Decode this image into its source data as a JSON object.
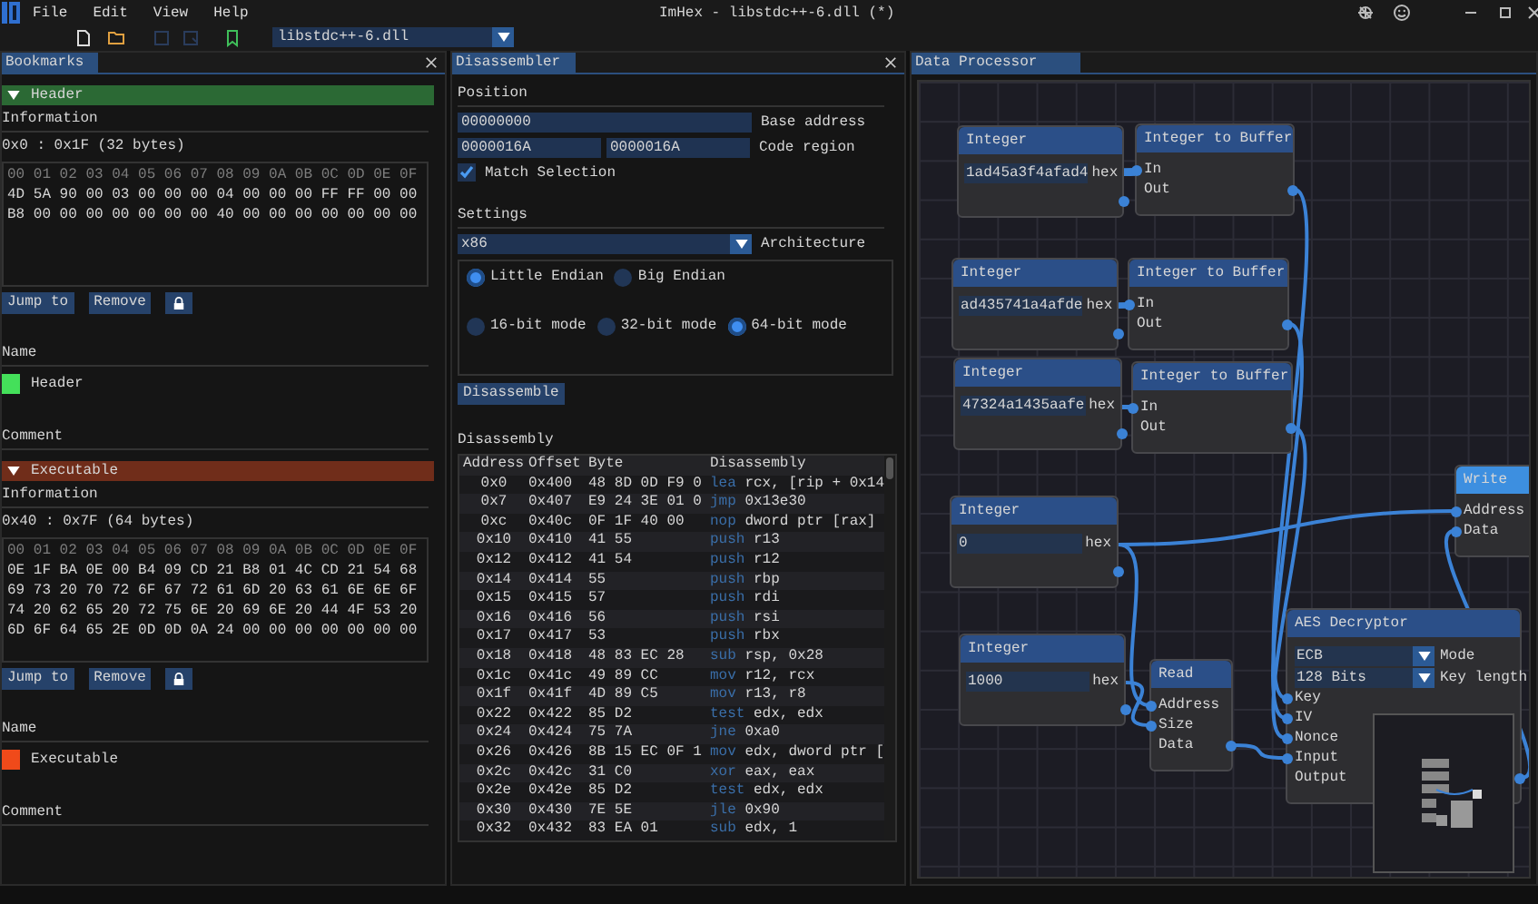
{
  "window": {
    "title": "ImHex - libstdc++-6.dll (*)"
  },
  "menu": [
    "File",
    "Edit",
    "View",
    "Help"
  ],
  "toolbar": {
    "file_selector": "libstdc++-6.dll"
  },
  "bookmarks": {
    "tab": "Bookmarks",
    "items": [
      {
        "title": "Header",
        "expanded": true,
        "color": "#44e05a",
        "info_label": "Information",
        "range": "0x0 : 0x1F (32 bytes)",
        "hex_header": "00 01 02 03 04 05 06 07 08 09 0A 0B 0C 0D 0E 0F",
        "hex_rows": [
          "4D 5A 90 00 03 00 00 00 04 00 00 00 FF FF 00 00",
          "B8 00 00 00 00 00 00 00 40 00 00 00 00 00 00 00"
        ],
        "buttons": [
          "Jump to",
          "Remove"
        ],
        "name_label": "Name",
        "name": "Header",
        "comment_label": "Comment"
      },
      {
        "title": "Executable",
        "expanded": true,
        "color": "#f04a1a",
        "info_label": "Information",
        "range": "0x40 : 0x7F (64 bytes)",
        "hex_header": "00 01 02 03 04 05 06 07 08 09 0A 0B 0C 0D 0E 0F",
        "hex_rows": [
          "0E 1F BA 0E 00 B4 09 CD 21 B8 01 4C CD 21 54 68",
          "69 73 20 70 72 6F 67 72 61 6D 20 63 61 6E 6E 6F",
          "74 20 62 65 20 72 75 6E 20 69 6E 20 44 4F 53 20",
          "6D 6F 64 65 2E 0D 0D 0A 24 00 00 00 00 00 00 00"
        ],
        "buttons": [
          "Jump to",
          "Remove"
        ],
        "name_label": "Name",
        "name": "Executable",
        "comment_label": "Comment"
      }
    ]
  },
  "disassembler": {
    "tab": "Disassembler",
    "position_label": "Position",
    "base_address": "00000000",
    "base_address_label": "Base address",
    "code_region": [
      "0000016A",
      "0000016A"
    ],
    "code_region_label": "Code region",
    "match_selection": {
      "label": "Match Selection",
      "checked": true
    },
    "settings_label": "Settings",
    "architecture": "x86",
    "architecture_label": "Architecture",
    "endianness": [
      {
        "label": "Little Endian",
        "selected": true
      },
      {
        "label": "Big Endian",
        "selected": false
      }
    ],
    "modes": [
      {
        "label": "16-bit mode",
        "selected": false
      },
      {
        "label": "32-bit mode",
        "selected": false
      },
      {
        "label": "64-bit mode",
        "selected": true
      }
    ],
    "disassemble_button": "Disassemble",
    "disassembly_label": "Disassembly",
    "table": {
      "columns": [
        "Address",
        "Offset",
        "Byte",
        "Disassembly"
      ],
      "rows": [
        {
          "address": "0x0",
          "offset": "0x400",
          "bytes": "48 8D 0D F9 0",
          "mnemonic": "lea",
          "operands": "rcx, [rip + 0x14"
        },
        {
          "address": "0x7",
          "offset": "0x407",
          "bytes": "E9 24 3E 01 0",
          "mnemonic": "jmp",
          "operands": "0x13e30"
        },
        {
          "address": "0xc",
          "offset": "0x40c",
          "bytes": "0F 1F 40 00",
          "mnemonic": "nop",
          "operands": "dword ptr [rax]"
        },
        {
          "address": "0x10",
          "offset": "0x410",
          "bytes": "41 55",
          "mnemonic": "push",
          "operands": "r13"
        },
        {
          "address": "0x12",
          "offset": "0x412",
          "bytes": "41 54",
          "mnemonic": "push",
          "operands": "r12"
        },
        {
          "address": "0x14",
          "offset": "0x414",
          "bytes": "55",
          "mnemonic": "push",
          "operands": "rbp"
        },
        {
          "address": "0x15",
          "offset": "0x415",
          "bytes": "57",
          "mnemonic": "push",
          "operands": "rdi"
        },
        {
          "address": "0x16",
          "offset": "0x416",
          "bytes": "56",
          "mnemonic": "push",
          "operands": "rsi"
        },
        {
          "address": "0x17",
          "offset": "0x417",
          "bytes": "53",
          "mnemonic": "push",
          "operands": "rbx"
        },
        {
          "address": "0x18",
          "offset": "0x418",
          "bytes": "48 83 EC 28",
          "mnemonic": "sub",
          "operands": "rsp, 0x28"
        },
        {
          "address": "0x1c",
          "offset": "0x41c",
          "bytes": "49 89 CC",
          "mnemonic": "mov",
          "operands": "r12, rcx"
        },
        {
          "address": "0x1f",
          "offset": "0x41f",
          "bytes": "4D 89 C5",
          "mnemonic": "mov",
          "operands": "r13, r8"
        },
        {
          "address": "0x22",
          "offset": "0x422",
          "bytes": "85 D2",
          "mnemonic": "test",
          "operands": "edx, edx"
        },
        {
          "address": "0x24",
          "offset": "0x424",
          "bytes": "75 7A",
          "mnemonic": "jne",
          "operands": "0xa0"
        },
        {
          "address": "0x26",
          "offset": "0x426",
          "bytes": "8B 15 EC 0F 1",
          "mnemonic": "mov",
          "operands": "edx, dword ptr ["
        },
        {
          "address": "0x2c",
          "offset": "0x42c",
          "bytes": "31 C0",
          "mnemonic": "xor",
          "operands": "eax, eax"
        },
        {
          "address": "0x2e",
          "offset": "0x42e",
          "bytes": "85 D2",
          "mnemonic": "test",
          "operands": "edx, edx"
        },
        {
          "address": "0x30",
          "offset": "0x430",
          "bytes": "7E 5E",
          "mnemonic": "jle",
          "operands": "0x90"
        },
        {
          "address": "0x32",
          "offset": "0x432",
          "bytes": "83 EA 01",
          "mnemonic": "sub",
          "operands": "edx, 1"
        }
      ]
    }
  },
  "data_processor": {
    "tab": "Data Processor",
    "nodes": [
      {
        "kind": "integer",
        "title": "Integer",
        "value": "1ad45a3f4afad4",
        "unit": "hex",
        "selected": false
      },
      {
        "kind": "converter",
        "title": "Integer to Buffer",
        "inputs": [
          "In"
        ],
        "outputs": [
          "Out"
        ],
        "selected": false
      },
      {
        "kind": "integer",
        "title": "Integer",
        "value": "ad435741a4afde",
        "unit": "hex",
        "selected": false
      },
      {
        "kind": "converter",
        "title": "Integer to Buffer",
        "inputs": [
          "In"
        ],
        "outputs": [
          "Out"
        ],
        "selected": false
      },
      {
        "kind": "integer",
        "title": "Integer",
        "value": "47324a1435aafe",
        "unit": "hex",
        "selected": false
      },
      {
        "kind": "converter",
        "title": "Integer to Buffer",
        "inputs": [
          "In"
        ],
        "outputs": [
          "Out"
        ],
        "selected": false
      },
      {
        "kind": "integer",
        "title": "Integer",
        "value": "0",
        "unit": "hex",
        "selected": false
      },
      {
        "kind": "integer",
        "title": "Integer",
        "value": "1000",
        "unit": "hex",
        "selected": false
      },
      {
        "kind": "converter",
        "title": "Read",
        "inputs": [
          "Address",
          "Size"
        ],
        "outputs": [
          "Data"
        ],
        "selected": false
      },
      {
        "kind": "converter",
        "title": "Write",
        "inputs": [
          "Address",
          "Data"
        ],
        "selected": true
      },
      {
        "kind": "decryptor",
        "title": "AES Decryptor",
        "settings": [
          {
            "value": "ECB",
            "label": "Mode"
          },
          {
            "value": "128 Bits",
            "label": "Key length"
          }
        ],
        "inputs": [
          "Key",
          "IV",
          "Nonce",
          "Input"
        ],
        "outputs": [
          "Output"
        ],
        "selected": false
      }
    ]
  }
}
